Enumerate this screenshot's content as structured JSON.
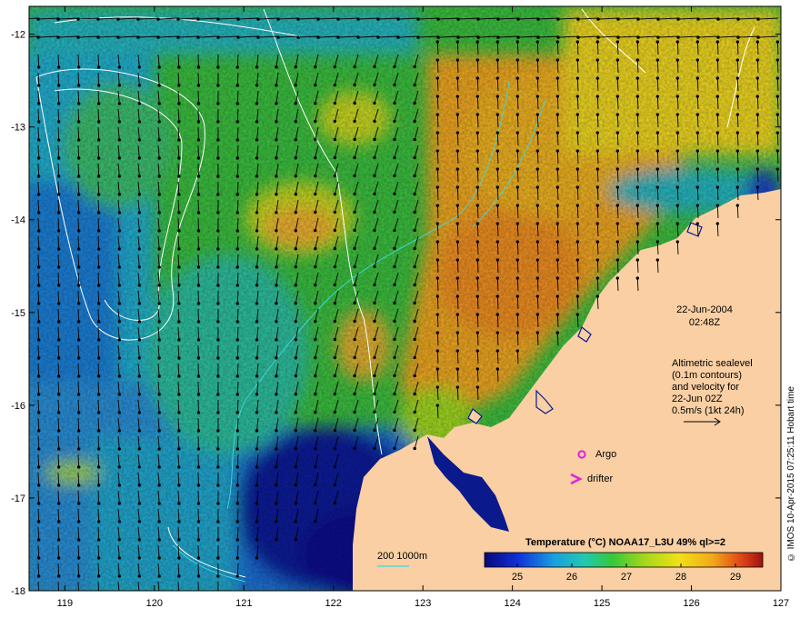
{
  "map": {
    "lon_ticks": [
      "119",
      "120",
      "121",
      "122",
      "123",
      "124",
      "125",
      "126",
      "127"
    ],
    "lat_ticks": [
      "-12",
      "-13",
      "-14",
      "-15",
      "-16",
      "-17",
      "-18"
    ],
    "lon_range": [
      118.6,
      127.0
    ],
    "lat_range": [
      -18.0,
      -11.7
    ]
  },
  "annotation": {
    "date": "22-Jun-2004",
    "time": "02:48Z",
    "sealevel_lines": [
      "Altimetric sealevel",
      "(0.1m contours)",
      "and velocity for",
      "22-Jun 02Z",
      "0.5m/s (1kt 24h)"
    ],
    "argo_label": "Argo",
    "drifter_label": "drifter",
    "bathy_label": "200  1000m"
  },
  "colorbar": {
    "title": "Temperature (°C) NOAA17_L3U 49% ql>=2",
    "ticks": [
      "25",
      "26",
      "27",
      "28",
      "29"
    ],
    "range": [
      24.4,
      29.5
    ]
  },
  "footer": {
    "credit": "© IMOS 10-Apr-2015 07:25:11 Hobart time"
  },
  "colors": {
    "land": "#f9cfa3",
    "deep_cold": "#0a1a8c",
    "cold": "#1b5fd6",
    "cyan": "#1fb4d6",
    "teal": "#2ec0a0",
    "green": "#3cc53c",
    "lime": "#a6d61a",
    "yellow": "#f0d814",
    "orange": "#f0a018",
    "argo": "#e020e0"
  }
}
